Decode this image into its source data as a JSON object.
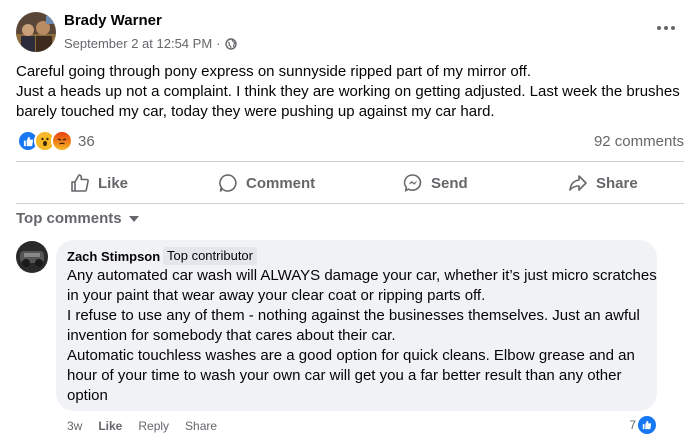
{
  "post": {
    "author": "Brady Warner",
    "timestamp": "September 2 at 12:54 PM",
    "separator": "·",
    "privacy_icon": "globe-icon",
    "lines": [
      "Careful going through pony express on sunnyside ripped part of my mirror off.",
      "Just a heads up not a complaint. I think they are working on getting adjusted. Last week the brushes",
      "barely touched my car, today they were pushing up against my car hard."
    ],
    "reaction_count": "36",
    "reaction_icons": [
      "like-icon",
      "wow-icon",
      "angry-icon"
    ],
    "comment_count": "92 comments"
  },
  "actions": {
    "like": "Like",
    "comment": "Comment",
    "send": "Send",
    "share": "Share"
  },
  "comments_section": {
    "sort_label": "Top comments"
  },
  "comment": {
    "author": "Zach Stimpson",
    "badge": "Top contributor",
    "lines": [
      "Any automated car wash will ALWAYS damage your car, whether it’s just micro scratches",
      "in your paint that wear away your clear coat or ripping parts off.",
      "I refuse to use any of them - nothing against the businesses themselves. Just an awful",
      "invention for somebody that cares about their car.",
      "Automatic touchless washes are a good option for quick cleans. Elbow grease and an",
      "hour of your time to wash your own car will get you a far better result than any other",
      "option"
    ],
    "age": "3w",
    "like_label": "Like",
    "reply_label": "Reply",
    "share_label": "Share",
    "reaction_count": "7"
  },
  "colors": {
    "like_blue": "#1877f2",
    "wow_yellow": "#f7b928",
    "angry_red": "#e9710f",
    "secondary_text": "#65676b",
    "bubble_bg": "#f0f2f5"
  }
}
